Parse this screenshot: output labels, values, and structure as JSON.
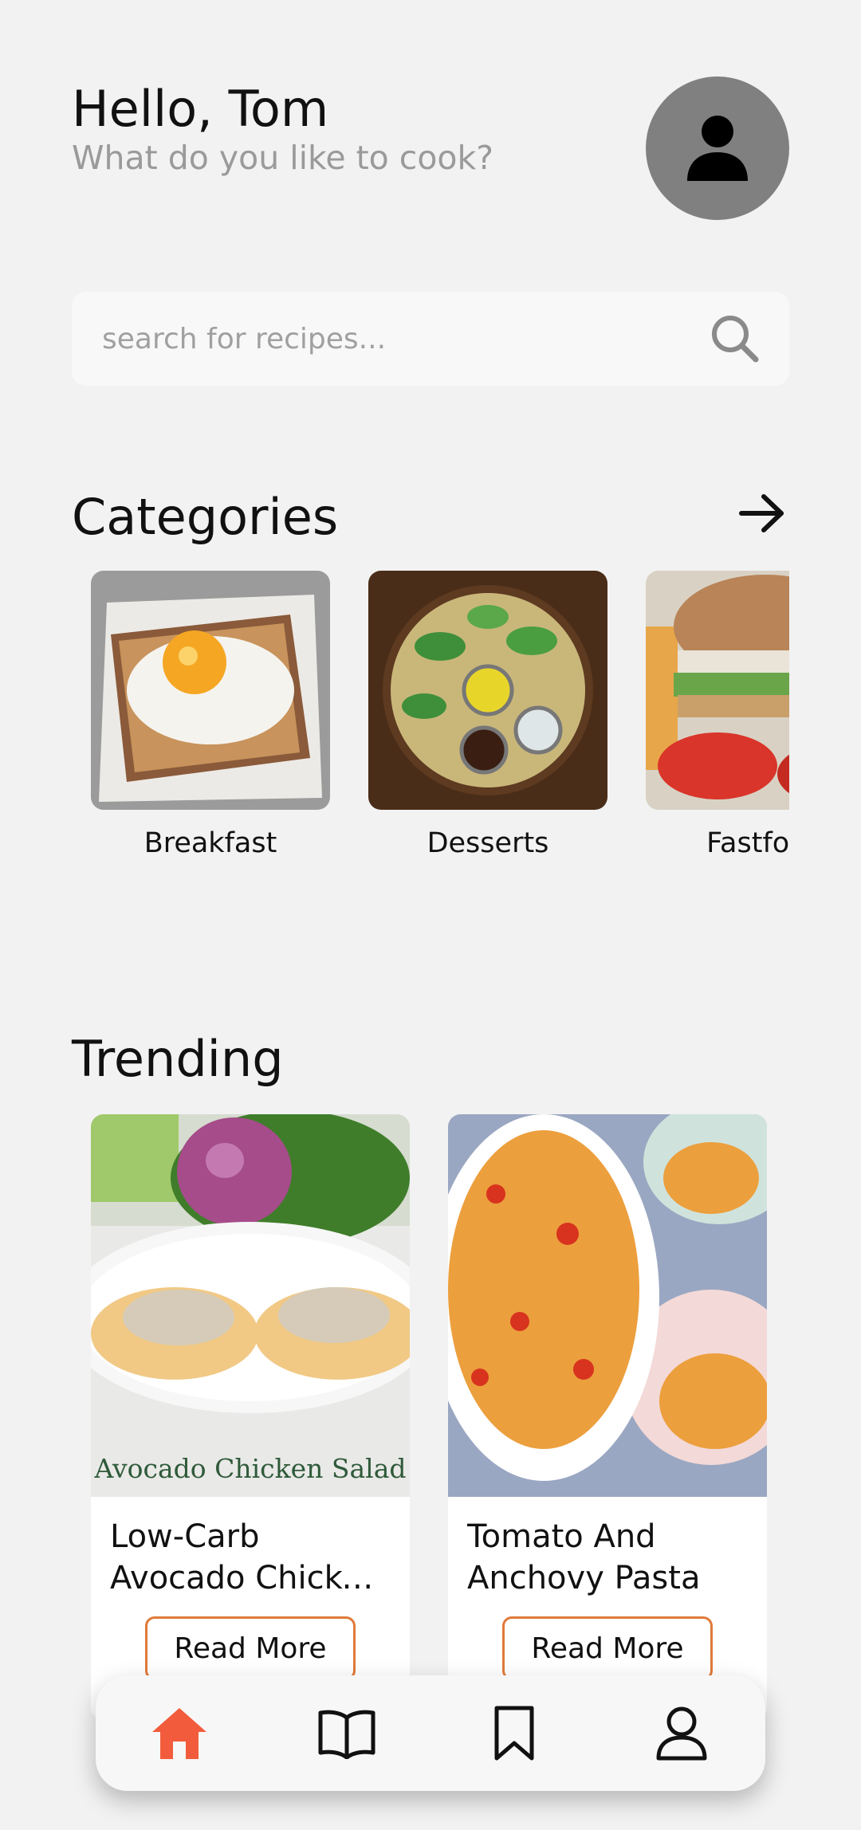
{
  "header": {
    "greeting": "Hello, Tom",
    "subtitle": "What do you like to cook?"
  },
  "avatar": {
    "icon": "user-icon",
    "color": "#808080"
  },
  "search": {
    "placeholder": "search for recipes...",
    "icon": "search-icon"
  },
  "categories": {
    "title": "Categories",
    "items": [
      {
        "label": "Breakfast"
      },
      {
        "label": "Desserts"
      },
      {
        "label": "Fastfood"
      }
    ]
  },
  "trending": {
    "title": "Trending",
    "items": [
      {
        "title": "Low-Carb Avocado Chicken Salad",
        "image_caption": "Avocado Chicken Salad",
        "button": "Read More"
      },
      {
        "title": "Tomato And Anchovy Pasta",
        "button": "Read More"
      }
    ]
  },
  "nav": {
    "accent": "#f25c3c",
    "items": [
      {
        "icon": "home-icon",
        "active": true
      },
      {
        "icon": "book-icon",
        "active": false
      },
      {
        "icon": "bookmark-icon",
        "active": false
      },
      {
        "icon": "profile-icon",
        "active": false
      }
    ]
  }
}
